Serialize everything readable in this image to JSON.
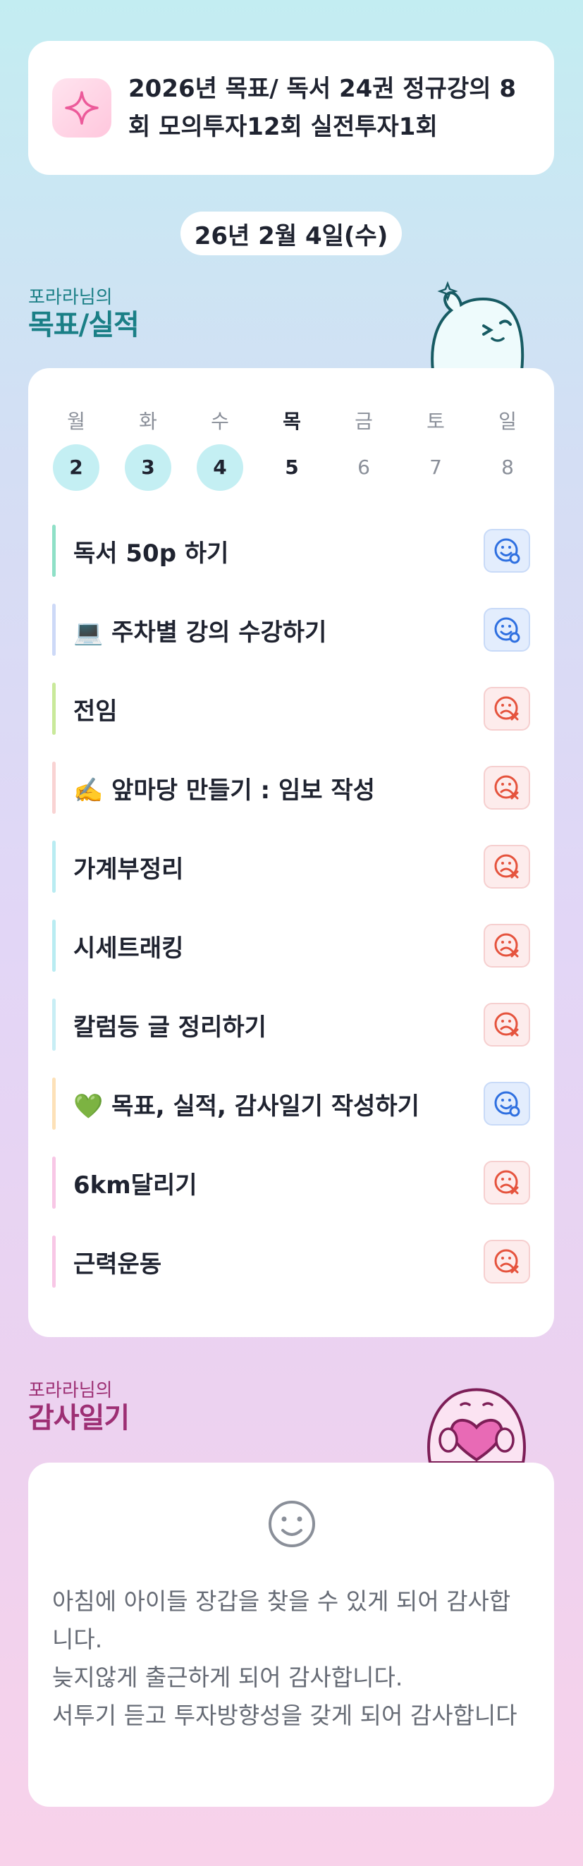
{
  "goal": {
    "icon": "sparkle-icon",
    "text": "2026년 목표/ 독서 24권 정규강의 8회 모의투자12회 실전투자1회"
  },
  "date": "26년 2월 4일(수)",
  "goals_section": {
    "subtitle": "포라라님의",
    "title": "목표/실적"
  },
  "week": {
    "days": [
      {
        "label": "월",
        "num": "2",
        "state": "done"
      },
      {
        "label": "화",
        "num": "3",
        "state": "done"
      },
      {
        "label": "수",
        "num": "4",
        "state": "done"
      },
      {
        "label": "목",
        "num": "5",
        "state": "today"
      },
      {
        "label": "금",
        "num": "6",
        "state": "future"
      },
      {
        "label": "토",
        "num": "7",
        "state": "future"
      },
      {
        "label": "일",
        "num": "8",
        "state": "future"
      }
    ]
  },
  "tasks": [
    {
      "label": "독서 50p 하기",
      "status": "done",
      "color": "#8fe0c7"
    },
    {
      "label": "💻 주차별 강의 수강하기",
      "status": "done",
      "color": "#cdd9f7"
    },
    {
      "label": "전임",
      "status": "missed",
      "color": "#c9e99a"
    },
    {
      "label": "✍️ 앞마당 만들기 : 임보 작성",
      "status": "missed",
      "color": "#f9d3d3"
    },
    {
      "label": "가계부정리",
      "status": "missed",
      "color": "#b9ecf2"
    },
    {
      "label": "시세트래킹",
      "status": "missed",
      "color": "#b9ecf2"
    },
    {
      "label": "칼럼등 글 정리하기",
      "status": "missed",
      "color": "#c8eef5"
    },
    {
      "label": "💚 목표, 실적, 감사일기 작성하기",
      "status": "done",
      "color": "#fde1b8"
    },
    {
      "label": "6km달리기",
      "status": "missed",
      "color": "#f8c7e6"
    },
    {
      "label": "근력운동",
      "status": "missed",
      "color": "#f8c7e6"
    }
  ],
  "gratitude_section": {
    "subtitle": "포라라님의",
    "title": "감사일기"
  },
  "gratitude": {
    "icon": "smile-icon",
    "text": "아침에 아이들 장갑을 찾을 수 있게 되어 감사합니다.\n늦지않게 출근하게 되어 감사합니다.\n서투기 듣고 투자방향성을 갖게 되어 감사합니다"
  },
  "colors": {
    "good": "#2e6fe0",
    "bad": "#e5533d",
    "teal": "#1a7f86",
    "plum": "#9d2f74"
  }
}
